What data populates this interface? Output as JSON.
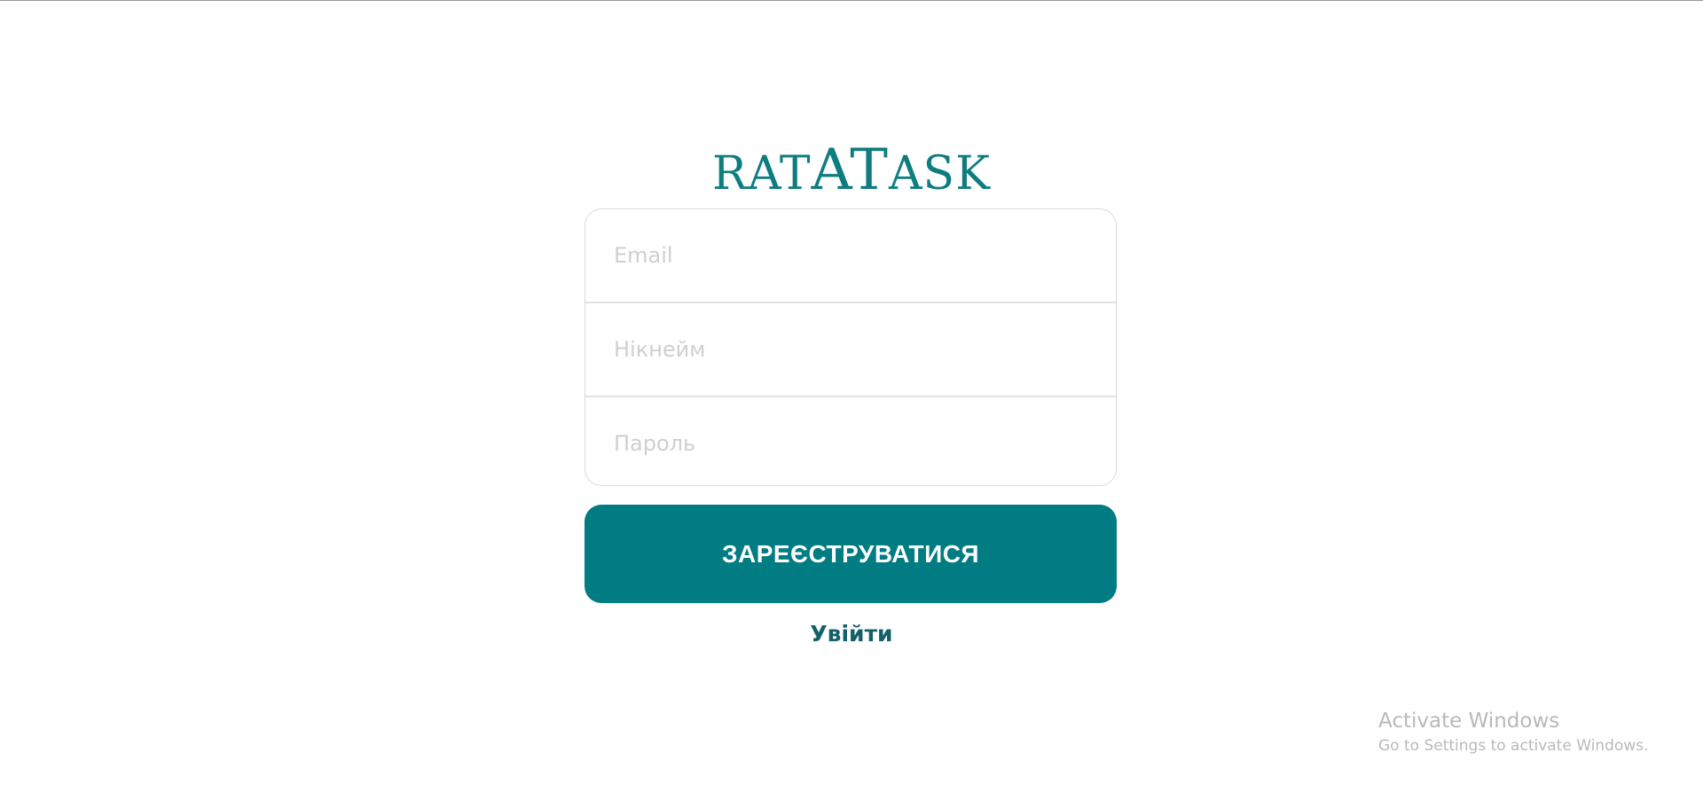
{
  "logo": {
    "part1": "RAT",
    "part2": "AT",
    "part3": "ASK"
  },
  "form": {
    "email_placeholder": "Email",
    "nickname_placeholder": "Нікнейм",
    "password_placeholder": "Пароль"
  },
  "register_button_label": "ЗАРЕЄСТРУВАТИСЯ",
  "login_link_label": "Увійти",
  "watermark": {
    "title": "Activate Windows",
    "subtitle": "Go to Settings to activate Windows."
  },
  "colors": {
    "brand": "#007c82",
    "logo": "#0e7d80",
    "link": "#14606a"
  }
}
